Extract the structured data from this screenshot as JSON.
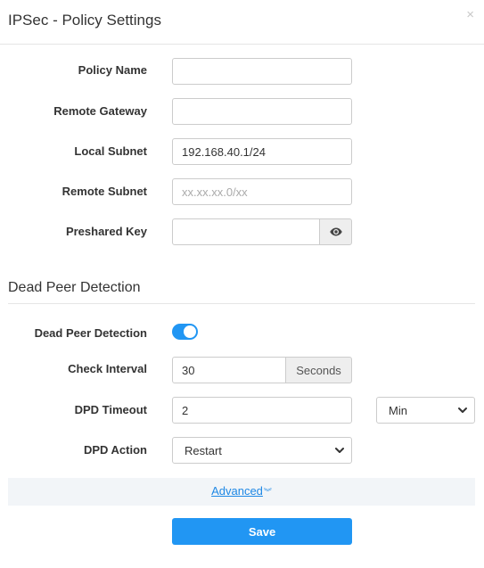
{
  "modal": {
    "title": "IPSec - Policy Settings",
    "close_glyph": "×"
  },
  "fields": {
    "policy_name": {
      "label": "Policy Name",
      "value": "",
      "placeholder": ""
    },
    "remote_gateway": {
      "label": "Remote Gateway",
      "value": "",
      "placeholder": ""
    },
    "local_subnet": {
      "label": "Local Subnet",
      "value": "192.168.40.1/24",
      "placeholder": ""
    },
    "remote_subnet": {
      "label": "Remote Subnet",
      "value": "",
      "placeholder": "xx.xx.xx.0/xx"
    },
    "preshared_key": {
      "label": "Preshared Key",
      "value": "",
      "placeholder": "",
      "reveal_icon": "eye-icon"
    }
  },
  "dpd": {
    "section_title": "Dead Peer Detection",
    "enable": {
      "label": "Dead Peer Detection",
      "enabled": true
    },
    "check_interval": {
      "label": "Check Interval",
      "value": "30",
      "unit": "Seconds"
    },
    "timeout": {
      "label": "DPD Timeout",
      "value": "2",
      "unit_selected": "Min"
    },
    "action": {
      "label": "DPD Action",
      "selected": "Restart"
    }
  },
  "advanced": {
    "label": "Advanced",
    "icon": "double-chevron-down-icon"
  },
  "save_label": "Save",
  "colors": {
    "accent": "#2196f3",
    "link": "#1e88e5",
    "advanced_bg": "#f2f5f8"
  }
}
